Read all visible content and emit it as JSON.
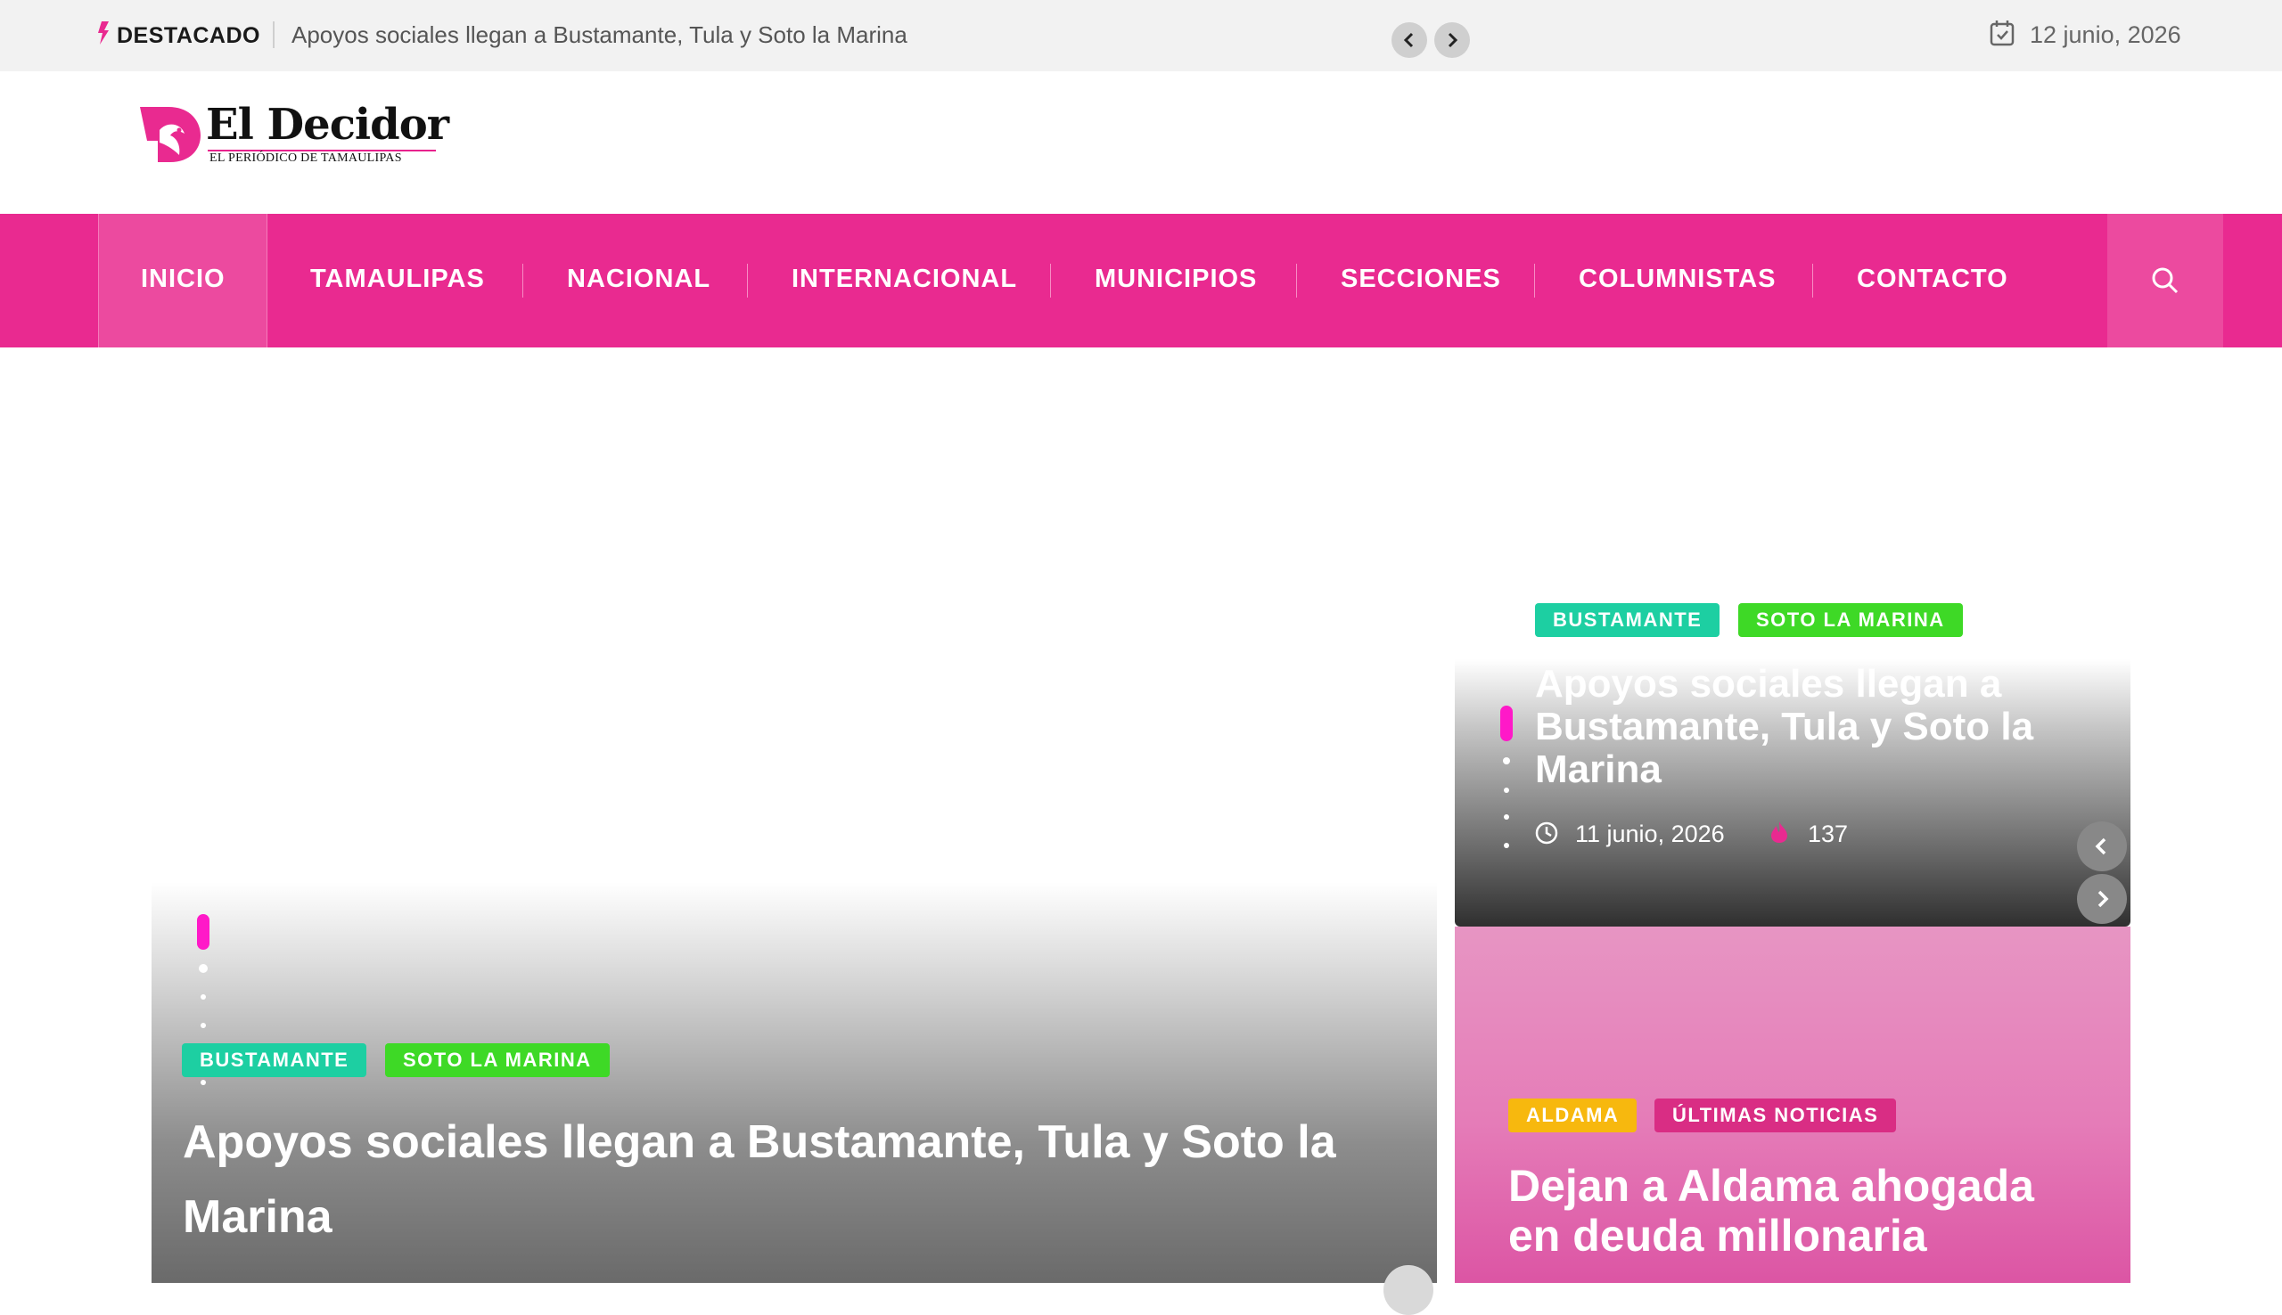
{
  "topbar": {
    "label": "DESTACADO",
    "headline": "Apoyos sociales llegan a Bustamante, Tula y Soto la Marina",
    "date": "12 junio, 2026",
    "icons": [
      "bolt-icon",
      "chevron-left-icon",
      "chevron-right-icon",
      "calendar-icon"
    ]
  },
  "logo": {
    "name": "El Decidor",
    "tagline": "EL PERIÓDICO DE TAMAULIPAS"
  },
  "nav": {
    "items": [
      "INICIO",
      "TAMAULIPAS",
      "NACIONAL",
      "INTERNACIONAL",
      "MUNICIPIOS",
      "SECCIONES",
      "COLUMNISTAS",
      "CONTACTO"
    ],
    "active": "INICIO"
  },
  "hero": {
    "tags": [
      "BUSTAMANTE",
      "SOTO LA MARINA"
    ],
    "title": "Apoyos sociales llegan a Bustamante, Tula y Soto la Marina"
  },
  "side_card_1": {
    "tags": [
      "BUSTAMANTE",
      "SOTO LA MARINA"
    ],
    "title": "Apoyos sociales llegan a Bustamante, Tula y Soto la Marina",
    "date": "11 junio, 2026",
    "views": "137"
  },
  "side_card_2": {
    "tags": [
      "ALDAMA",
      "ÚLTIMAS NOTICIAS"
    ],
    "title": "Dejan a Aldama ahogada en deuda millonaria"
  },
  "colors": {
    "brand_pink": "#e92a90",
    "slider_dot": "#ff19c8",
    "tag_teal": "#1dcfa2",
    "tag_green": "#3ed926",
    "tag_yellow": "#f7b80e",
    "tag_magenta": "#d92d84"
  }
}
